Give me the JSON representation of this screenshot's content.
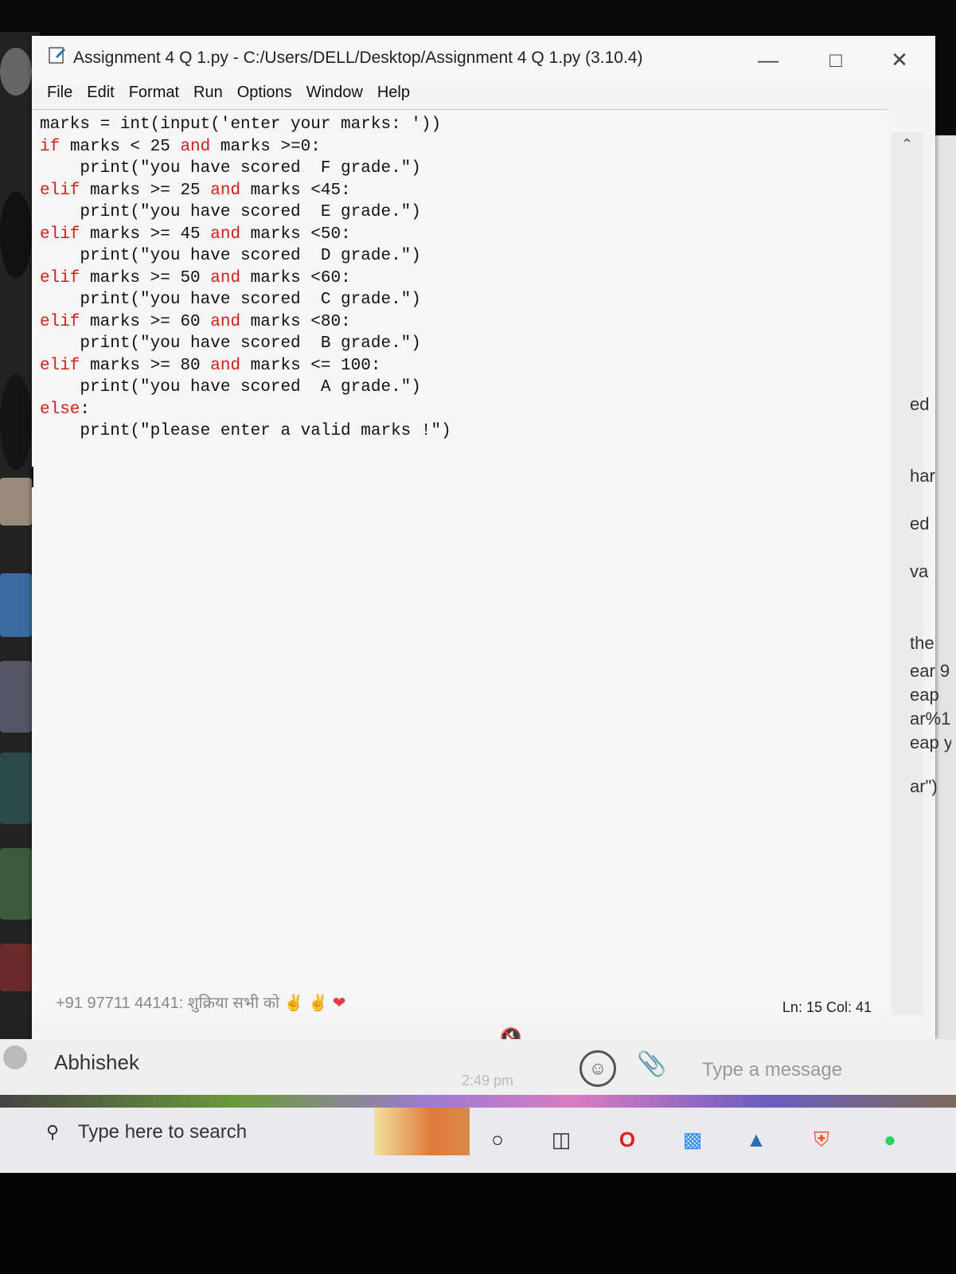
{
  "window": {
    "title": "Assignment 4 Q 1.py - C:/Users/DELL/Desktop/Assignment 4 Q 1.py (3.10.4)",
    "minimize_icon": "minimize-icon",
    "maximize_icon": "maximize-icon",
    "close_icon": "close-icon"
  },
  "menu": [
    "File",
    "Edit",
    "Format",
    "Run",
    "Options",
    "Window",
    "Help"
  ],
  "code_lines": [
    [
      {
        "t": "marks = int(input('enter your marks: '))",
        "k": false
      }
    ],
    [
      {
        "t": "if",
        "k": true
      },
      {
        "t": " marks < 25 ",
        "k": false
      },
      {
        "t": "and",
        "k": true
      },
      {
        "t": " marks >=0:",
        "k": false
      }
    ],
    [
      {
        "t": "    print(\"you have scored  F grade.\")",
        "k": false
      }
    ],
    [
      {
        "t": "elif",
        "k": true
      },
      {
        "t": " marks >= 25 ",
        "k": false
      },
      {
        "t": "and",
        "k": true
      },
      {
        "t": " marks <45:",
        "k": false
      }
    ],
    [
      {
        "t": "    print(\"you have scored  E grade.\")",
        "k": false
      }
    ],
    [
      {
        "t": "elif",
        "k": true
      },
      {
        "t": " marks >= 45 ",
        "k": false
      },
      {
        "t": "and",
        "k": true
      },
      {
        "t": " marks <50:",
        "k": false
      }
    ],
    [
      {
        "t": "    print(\"you have scored  D grade.\")",
        "k": false
      }
    ],
    [
      {
        "t": "elif",
        "k": true
      },
      {
        "t": " marks >= 50 ",
        "k": false
      },
      {
        "t": "and",
        "k": true
      },
      {
        "t": " marks <60:",
        "k": false
      }
    ],
    [
      {
        "t": "    print(\"you have scored  C grade.\")",
        "k": false
      }
    ],
    [
      {
        "t": "elif",
        "k": true
      },
      {
        "t": " marks >= 60 ",
        "k": false
      },
      {
        "t": "and",
        "k": true
      },
      {
        "t": " marks <80:",
        "k": false
      }
    ],
    [
      {
        "t": "    print(\"you have scored  B grade.\")",
        "k": false
      }
    ],
    [
      {
        "t": "elif",
        "k": true
      },
      {
        "t": " marks >= 80 ",
        "k": false
      },
      {
        "t": "and",
        "k": true
      },
      {
        "t": " marks <= 100:",
        "k": false
      }
    ],
    [
      {
        "t": "    print(\"you have scored  A grade.\")",
        "k": false
      }
    ],
    [
      {
        "t": "else",
        "k": true
      },
      {
        "t": ":",
        "k": false
      }
    ],
    [
      {
        "t": "    print(\"please enter a valid marks !\")",
        "k": false
      }
    ]
  ],
  "status": {
    "ln_col": "Ln: 15   Col: 41"
  },
  "chat": {
    "preview": "+91 97711 44141: शुक्रिया सभी को",
    "contact": "Abhishek",
    "time": "2:49 pm",
    "message_placeholder": "Type a message"
  },
  "taskbar": {
    "search_placeholder": "Type here to search"
  },
  "right_fragments": [
    "ed",
    "har",
    "ed",
    "va",
    "the",
    "ear 9",
    "eap",
    "ar%1",
    "eap y",
    "ar\")"
  ],
  "colors": {
    "keyword": "#d0201a",
    "text": "#111111",
    "editor_bg": "#f6f6f6"
  }
}
